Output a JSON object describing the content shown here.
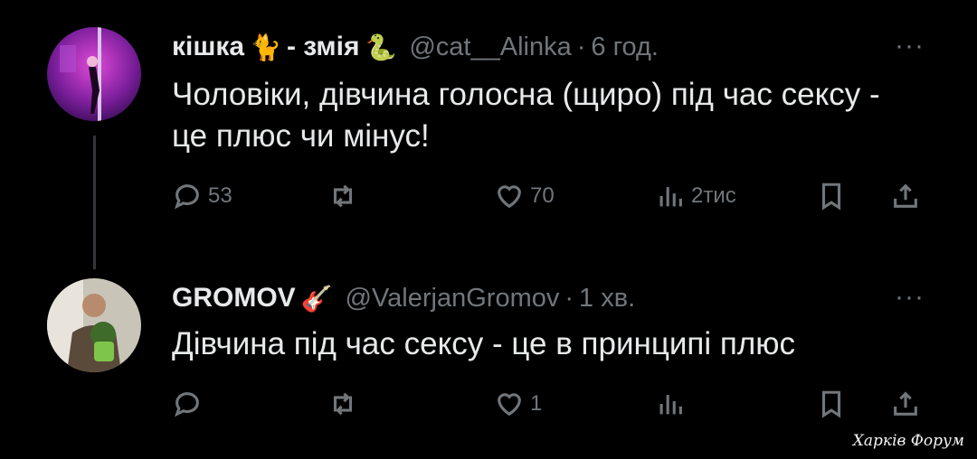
{
  "tweets": [
    {
      "display_name": "кішка",
      "name_suffix": "- змія",
      "emoji1": "🐈",
      "emoji2": "🐍",
      "handle": "@cat__Alinka",
      "separator": "·",
      "time": "6 год.",
      "more": "···",
      "text": "Чоловіки, дівчина голосна (щиро) під час сексу - це плюс чи мінус!",
      "reply_count": "53",
      "retweet_count": "",
      "like_count": "70",
      "view_count": "2тис"
    },
    {
      "display_name": "GROMOV",
      "emoji1": "🎸",
      "handle": "@ValerjanGromov",
      "separator": "·",
      "time": "1 хв.",
      "more": "···",
      "text": "Дівчина під час сексу - це в принципі плюс",
      "reply_count": "",
      "retweet_count": "",
      "like_count": "1",
      "view_count": ""
    }
  ],
  "watermark": "Харків Форум",
  "icons": [
    "reply-icon",
    "retweet-icon",
    "like-icon",
    "views-icon",
    "bookmark-icon",
    "share-icon"
  ]
}
